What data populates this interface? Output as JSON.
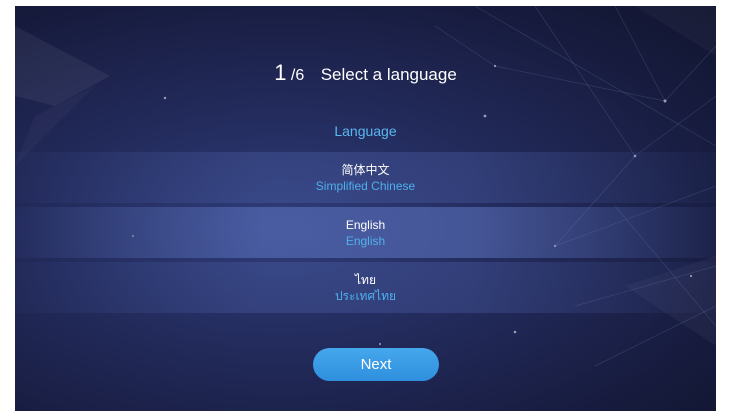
{
  "header": {
    "step_current": "1",
    "step_total": "/6",
    "title": "Select a language"
  },
  "section_label": "Language",
  "languages": [
    {
      "native": "简体中文",
      "sub": "Simplified Chinese",
      "selected": false
    },
    {
      "native": "English",
      "sub": "English",
      "selected": true
    },
    {
      "native": "ไทย",
      "sub": "ประเทศไทย",
      "selected": false
    }
  ],
  "next_button": {
    "label": "Next"
  },
  "colors": {
    "background": "#1c2350",
    "accent": "#4fb0ec",
    "button": "#3a9ae6",
    "text": "#ffffff"
  }
}
